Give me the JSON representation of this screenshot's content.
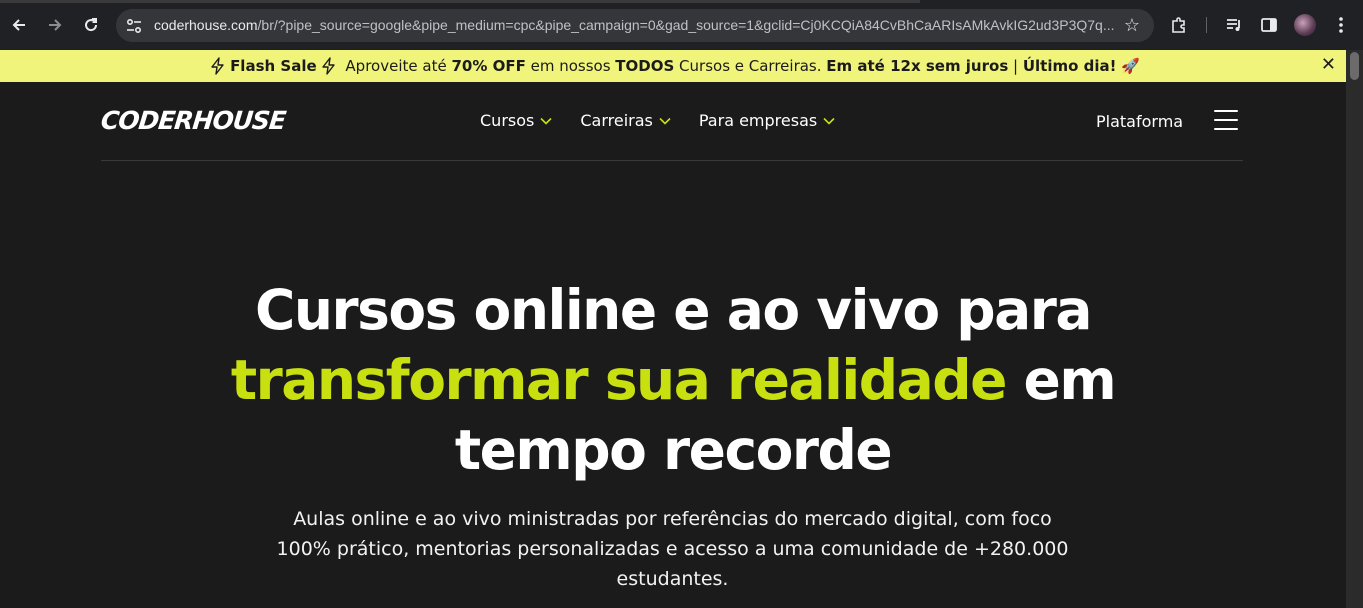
{
  "browser": {
    "url_host": "coderhouse.com",
    "url_rest": "/br/?pipe_source=google&pipe_medium=cpc&pipe_campaign=0&gad_source=1&gclid=Cj0KCQiA84CvBhCaARIsAMkAvkIG2ud3P3Q7q..."
  },
  "banner": {
    "flash_sale": "Flash Sale",
    "text_1": " Aproveite até ",
    "discount": "70% OFF",
    "text_2": " em nossos ",
    "todos": "TODOS",
    "text_3": " Cursos e Carreiras. ",
    "installments": "Em até 12x sem juros",
    "separator": " | ",
    "last_day": "Último dia!",
    "rocket": " 🚀",
    "close": "✕",
    "bg_color": "#f1f47a"
  },
  "header": {
    "logo": "CODERHOUSE",
    "nav": [
      {
        "label": "Cursos"
      },
      {
        "label": "Carreiras"
      },
      {
        "label": "Para empresas"
      }
    ],
    "platform_link": "Plataforma",
    "menu_icon": "hamburger-icon"
  },
  "hero": {
    "title_line1": "Cursos online e ao vivo para",
    "title_accent": "transformar sua realidade",
    "title_after_accent": " em",
    "title_line3": "tempo recorde",
    "subtitle": "Aulas online e ao vivo ministradas por referências do mercado digital, com foco 100% prático, mentorias personalizadas e acesso a uma comunidade de +280.000 estudantes.",
    "accent_color": "#c8e00f"
  }
}
